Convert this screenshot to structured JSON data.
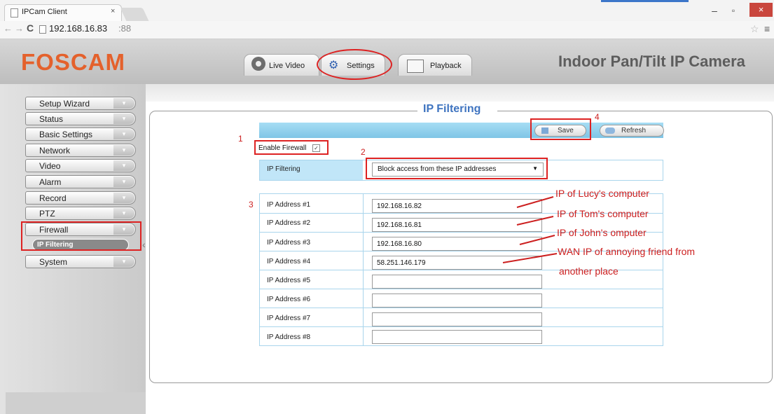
{
  "browser": {
    "tab_title": "IPCam Client",
    "tab_close": "×",
    "url_host": "192.168.16.83",
    "url_port": ":88",
    "back_icon": "←",
    "forward_icon": "→",
    "reload_icon": "C",
    "star_icon": "☆",
    "menu_icon": "≡",
    "minimize": "–",
    "maximize": "▫",
    "close": "×"
  },
  "header": {
    "logo": "FOSCAM",
    "camera_title": "Indoor Pan/Tilt IP Camera",
    "tabs": [
      {
        "label": "Live Video",
        "icon": "webcam-icon"
      },
      {
        "label": "Settings",
        "icon": "settings-icon"
      },
      {
        "label": "Playback",
        "icon": "film-icon"
      }
    ]
  },
  "sidebar": {
    "items": [
      {
        "label": "Setup Wizard"
      },
      {
        "label": "Status"
      },
      {
        "label": "Basic Settings"
      },
      {
        "label": "Network"
      },
      {
        "label": "Video"
      },
      {
        "label": "Alarm"
      },
      {
        "label": "Record"
      },
      {
        "label": "PTZ"
      },
      {
        "label": "Firewall"
      },
      {
        "label": "System"
      }
    ],
    "sub_item": "IP Filtering",
    "chevron": "▾"
  },
  "panel": {
    "title": "IP Filtering",
    "save_label": "Save",
    "refresh_label": "Refresh",
    "enable_firewall_label": "Enable Firewall",
    "enable_firewall_checked": true,
    "check_mark": "✓",
    "filter_label": "IP Filtering",
    "filter_value": "Block access from these IP addresses",
    "select_arrow": "▼",
    "ip_rows": [
      {
        "label": "IP Address #1",
        "value": "192.168.16.82"
      },
      {
        "label": "IP Address #2",
        "value": "192.168.16.81"
      },
      {
        "label": "IP Address #3",
        "value": "192.168.16.80"
      },
      {
        "label": "IP Address #4",
        "value": "58.251.146.179"
      },
      {
        "label": "IP Address #5",
        "value": ""
      },
      {
        "label": "IP Address #6",
        "value": ""
      },
      {
        "label": "IP Address #7",
        "value": ""
      },
      {
        "label": "IP Address #8",
        "value": ""
      }
    ]
  },
  "annotations": {
    "step1": "1",
    "step2": "2",
    "step3": "3",
    "step4": "4",
    "note_ip1": "IP of Lucy's computer",
    "note_ip2": "IP of Tom's computer",
    "note_ip3": "IP of John's omputer",
    "note_ip4_line1": "WAN IP of annoying friend from",
    "note_ip4_line2": "another place"
  },
  "colors": {
    "logo": "#e4612c",
    "panel_title": "#3f74c0",
    "toolbar": "#8fd0ec",
    "annotation_red": "#cc1f1f"
  }
}
